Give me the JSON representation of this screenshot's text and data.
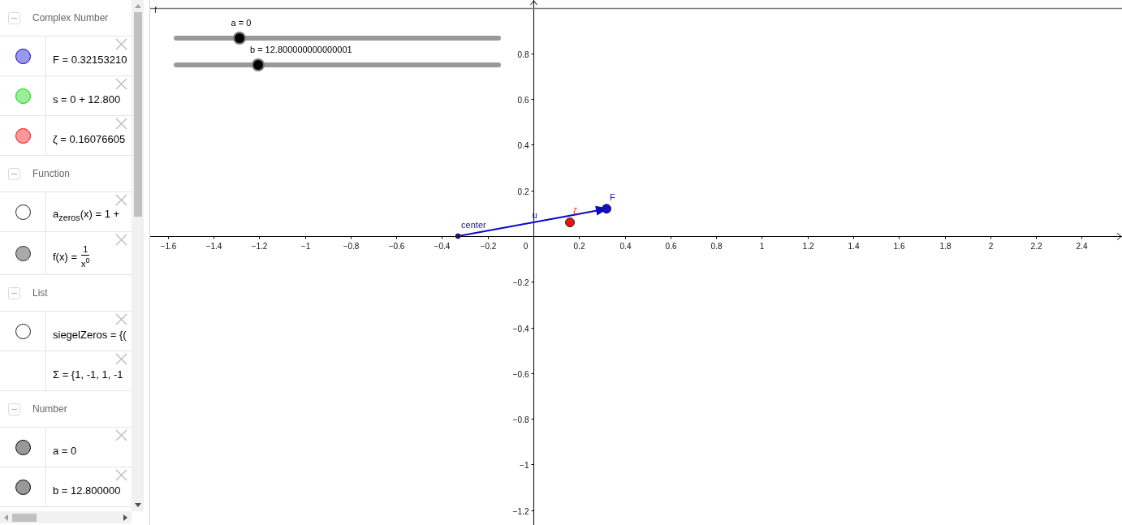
{
  "algebra_view": {
    "groups": [
      {
        "title": "Complex Number",
        "expanded": true,
        "items": [
          {
            "kind": "text",
            "marble": {
              "visible": true,
              "color": "#9999ee"
            },
            "text": "F = 0.32153210"
          },
          {
            "kind": "text",
            "marble": {
              "visible": true,
              "color": "#99ee99"
            },
            "text": "s = 0 + 12.800"
          },
          {
            "kind": "text",
            "marble": {
              "visible": true,
              "color": "#ff9999"
            },
            "text": "ζ = 0.16076605"
          }
        ]
      },
      {
        "title": "Function",
        "expanded": true,
        "items": [
          {
            "kind": "text",
            "marble": {
              "visible": false
            },
            "text": "a$_{zeros}$(x) = 1 +"
          },
          {
            "kind": "fraction",
            "marble": {
              "visible": true,
              "color": "#aaaaaa"
            },
            "lhs": "f(x) =",
            "numerator": "1",
            "denominator": "x$^{0}$"
          }
        ]
      },
      {
        "title": "List",
        "expanded": true,
        "items": [
          {
            "kind": "text",
            "marble": {
              "visible": false
            },
            "text": "siegelZeros = {("
          },
          {
            "kind": "text",
            "text": "Σ = {1, -1, 1, -1"
          }
        ]
      },
      {
        "title": "Number",
        "expanded": true,
        "items": [
          {
            "kind": "text",
            "marble": {
              "visible": true,
              "color": "#999999"
            },
            "text": "a = 0"
          },
          {
            "kind": "text",
            "marble": {
              "visible": true,
              "color": "#999999"
            },
            "text": "b = 12.800000"
          }
        ]
      }
    ]
  },
  "graphics_view": {
    "sliders": [
      {
        "label": "a = 0",
        "level": 0.2
      },
      {
        "label": "b = 12.800000000000001",
        "level": 0.258
      }
    ],
    "origin_label": "0",
    "chart_data": {
      "type": "scatter",
      "xlim": [
        -1.677,
        2.576
      ],
      "ylim": [
        -1.265,
        1.034
      ],
      "xticks": [
        {
          "value": -1.6,
          "label": "−1.6"
        },
        {
          "value": -1.4,
          "label": "−1.4"
        },
        {
          "value": -1.2,
          "label": "−1.2"
        },
        {
          "value": -1,
          "label": "−1"
        },
        {
          "value": -0.8,
          "label": "−0.8"
        },
        {
          "value": -0.6,
          "label": "−0.6"
        },
        {
          "value": -0.4,
          "label": "−0.4"
        },
        {
          "value": -0.2,
          "label": "−0.2"
        },
        0.2,
        0.4,
        0.6,
        0.8,
        1,
        1.2,
        1.4,
        1.6,
        1.8,
        2,
        2.2,
        2.4
      ],
      "yticks": [
        {
          "value": -1.2,
          "label": "−1.2"
        },
        {
          "value": -1,
          "label": "−1"
        },
        {
          "value": -0.8,
          "label": "−0.8"
        },
        {
          "value": -0.6,
          "label": "−0.6"
        },
        {
          "value": -0.4,
          "label": "−0.4"
        },
        {
          "value": -0.2,
          "label": "−0.2"
        },
        0.2,
        0.4,
        0.6,
        0.8
      ],
      "x": [
        -0.33,
        0.16,
        0.32
      ],
      "series": [
        {
          "name": "u",
          "type": "line",
          "color": "#0b0bc4",
          "values": [
            0,
            0.09,
            0.12
          ]
        },
        {
          "name": "center",
          "marker": "dot",
          "color": "#14148c",
          "values": [
            0,
            null,
            null
          ]
        },
        {
          "name": "ζ",
          "marker": "circle",
          "color": "#ee1111",
          "values": [
            null,
            0.06,
            null
          ]
        },
        {
          "name": "F",
          "marker": "circle",
          "color": "#1010cc",
          "values": [
            null,
            null,
            0.12
          ]
        }
      ],
      "ref_lines": [
        {
          "axis": "y",
          "value": 1,
          "label": "f",
          "color": "#808080"
        }
      ]
    }
  }
}
